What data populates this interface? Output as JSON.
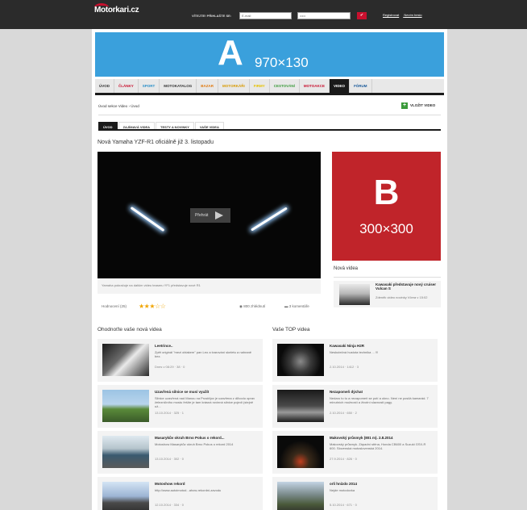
{
  "topbar": {
    "logo": "Motorkari.cz",
    "login_label": "VÍTEJTE! PŘIHLAŠTE SE:",
    "email_placeholder": "E-mail",
    "password_placeholder": "•••••",
    "login_button": "✔",
    "register": "Registrovat",
    "forgot": "Nevím heslo"
  },
  "banner_a": {
    "letter": "A",
    "size": "970×130"
  },
  "nav": [
    "ÚVOD",
    "ČLÁNKY",
    "SPORT",
    "MOTOKATALOG",
    "BAZAR",
    "MOTORKÁŘI",
    "FIRMY",
    "CESTOVÁNÍ",
    "MOTOAKCE",
    "VIDEO",
    "FÓRUM"
  ],
  "nav_colors": [
    "#333333",
    "#c8102e",
    "#2a8fc8",
    "#333333",
    "#e07a10",
    "#d89a00",
    "#e6c200",
    "#3a9a3a",
    "#c8102e",
    "#ffffff",
    "#1a5a9a"
  ],
  "breadcrumb": "Úvod sekce Video  ›  Úvod",
  "upload": "VLOŽIT VIDEO",
  "subtabs": [
    "ÚVOD",
    "ZAJÍMAVÁ VIDEA",
    "TESTY A NOVINKY",
    "VAŠE VIDEA"
  ],
  "featured": {
    "title": "Nová Yamaha YZF-R1 oficiálně již 3. listopadu",
    "play_label": "Přehrát",
    "description": "Yamaha pokračuje na dalším videu teaseru YF1 představuje nové R1",
    "rating_label": "Hodnocení (25)",
    "stars": "★★★☆☆",
    "views": "800 zhlédnutí",
    "comments": "3 komentáře"
  },
  "banner_b": {
    "letter": "B",
    "size": "300×300"
  },
  "sidebar": {
    "heading": "Nová videa",
    "item": {
      "title": "Kawasaki představuje nový cruiser Vulcan S",
      "meta": "Zdeněk video novinky Včera v 15:02"
    }
  },
  "left_section": {
    "heading": "Ohodnoťte vaše nová videa",
    "items": [
      {
        "title": "Leetrince..",
        "desc": "Zpět originál \"mezi oblakem\" pan Leo a tvarování skeletu a nahraně bez.",
        "meta": "Dnes v 08:29 · 38 · 0"
      },
      {
        "title": "Uzavřená silnice se musí využít",
        "desc": "Silnice uzavřená nad Manou na Prostějov je uzavřena z důvodu oprav železničního mostu řešíte je tam krásná rovinná silnice pojedí (stejně už...",
        "meta": "13.10.2014 · 325 · 1"
      },
      {
        "title": "Masarykův okruh Brno Pokus o rekord...",
        "desc": "Motoshow Masarykův okruh Brno Pokus o rekord 2014",
        "meta": "13.10.2014 · 302 · 0"
      },
      {
        "title": "Motoshow rekord",
        "desc": "http://www.autoimotod...ahow-rekordni-zavodu",
        "meta": "12.10.2014 · 334 · 0"
      }
    ]
  },
  "right_section": {
    "heading": "Vaše TOP videa",
    "items": [
      {
        "title": "Kawasaki Ninja H2R",
        "desc": "Neskutečná hustota technika ... !!!",
        "meta": "2.10.2014 · 1412 · 3"
      },
      {
        "title": "Nezapomeň dýchat",
        "desc": "Nedaro to tu a nezapomeň se potí a okno. Není ne posílá kamarád. 7 minutních možností a životní slavnosti pagy.",
        "meta": "2.10.2014 · 650 · 2"
      },
      {
        "title": "Makovský průsmyk (801 m). 2.8.2014",
        "desc": "Makovský průsmyk. Západní stěna, Honda CB600 a Suzuki GSX-R 600. Slovenská motoslovenská 2014.",
        "meta": "27.9.2014 · 826 · 0"
      },
      {
        "title": "orli hnízdo 2014",
        "desc": "Nejde motodovka",
        "meta": "5.10.2014 · 671 · 0"
      }
    ]
  }
}
